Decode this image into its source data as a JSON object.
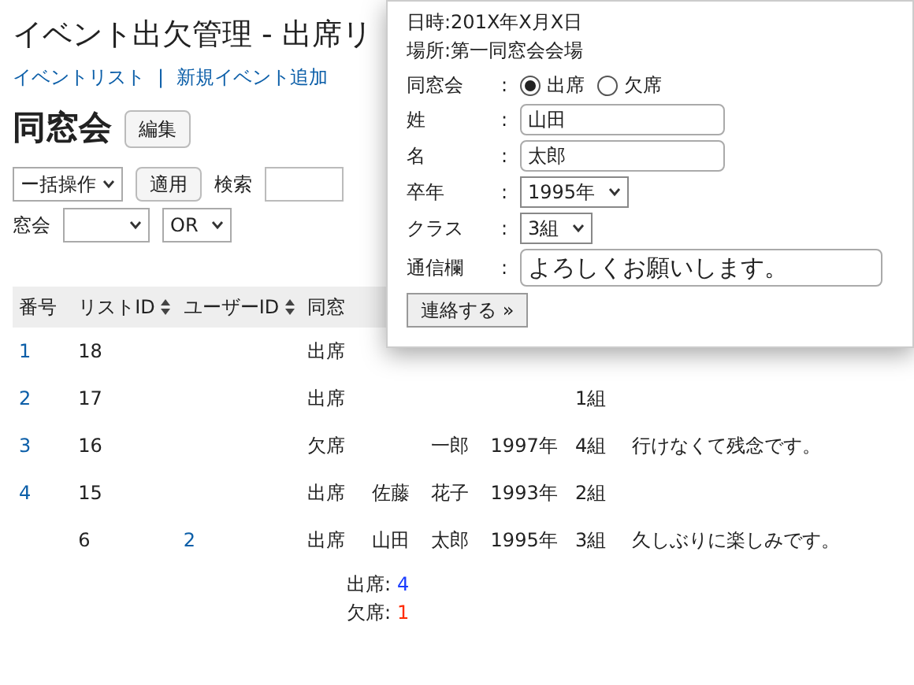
{
  "admin": {
    "title": "イベント出欠管理 - 出席リ",
    "links": [
      "イベントリスト",
      "新規イベント追加"
    ],
    "separator": "|",
    "event_name": "同窓会",
    "edit_button": "編集",
    "bulk_select": "ー括操作",
    "apply_button": "適用",
    "search_label": "検索",
    "filter_label": "窓会",
    "operator_select": "OR",
    "table": {
      "columns": [
        {
          "label": "番号",
          "sortable": false
        },
        {
          "label": "リストID",
          "sortable": true
        },
        {
          "label": "ユーザーID",
          "sortable": true
        },
        {
          "label": "同窓",
          "sortable": false
        }
      ],
      "rows": [
        {
          "number": "1",
          "list_id": "18",
          "attendance": "出席"
        },
        {
          "number": "2",
          "list_id": "17",
          "attendance": "出席",
          "class": "1組"
        },
        {
          "number": "3",
          "list_id": "16",
          "attendance": "欠席",
          "given_name": "一郎",
          "year": "1997年",
          "class": "4組",
          "message": "行けなくて残念です。"
        },
        {
          "number": "4",
          "list_id": "15",
          "attendance": "出席",
          "surname": "佐藤",
          "given_name": "花子",
          "year": "1993年",
          "class": "2組"
        },
        {
          "list_id": "6",
          "user_id": "2",
          "attendance": "出席",
          "surname": "山田",
          "given_name": "太郎",
          "year": "1995年",
          "class": "3組",
          "message": "久しぶりに楽しみです。"
        }
      ]
    },
    "summary": [
      {
        "label": "出席:",
        "count": "4",
        "color": "#1a3cff"
      },
      {
        "label": "欠席:",
        "count": "1",
        "color": "#ff2a00"
      }
    ]
  },
  "form": {
    "date": "日時:201X年X月X日",
    "place": "場所:第一同窓会会場",
    "fields": [
      {
        "kind": "radio",
        "label": "同窓会",
        "options": [
          {
            "label": "出席",
            "selected": true
          },
          {
            "label": "欠席",
            "selected": false
          }
        ]
      },
      {
        "kind": "text",
        "label": "姓",
        "value": "山田"
      },
      {
        "kind": "text",
        "label": "名",
        "value": "太郎"
      },
      {
        "kind": "select",
        "label": "卒年",
        "value": "1995年"
      },
      {
        "kind": "select",
        "label": "クラス",
        "value": "3組"
      },
      {
        "kind": "textarea",
        "label": "通信欄",
        "value": "よろしくお願いします。"
      }
    ],
    "separator": ":",
    "submit_button": "連絡する »"
  }
}
